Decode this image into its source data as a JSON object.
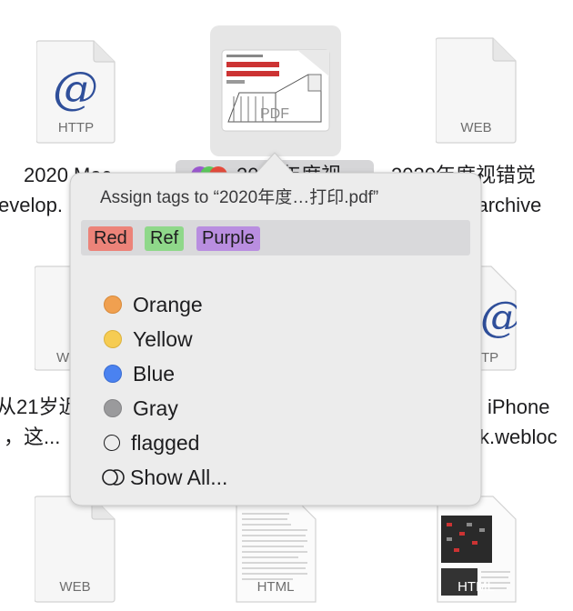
{
  "files": {
    "top_left": {
      "badge": "HTTP",
      "label1": "2020 Mac",
      "label2": "evelop."
    },
    "top_center": {
      "badge": "PDF",
      "label": "2020年度视"
    },
    "top_right": {
      "badge": "WEB",
      "label1": "2020年度视错觉",
      "label2": ".webarchive"
    },
    "mid_left": {
      "badge": "WE",
      "label1": "从21岁近",
      "label2": "，这..."
    },
    "mid_right": {
      "badge": "TP",
      "label1": "iPhone",
      "label2": "k.webloc"
    },
    "bottom_left": {
      "badge": "WEB"
    },
    "bottom_center": {
      "badge": "HTML"
    },
    "bottom_right": {
      "badge": "HTML"
    }
  },
  "popover": {
    "title": "Assign tags to “2020年度…打印.pdf”",
    "assigned_tags": [
      {
        "label": "Red",
        "color": "#ec8379"
      },
      {
        "label": "Ref",
        "color": "#8fd88a"
      },
      {
        "label": "Purple",
        "color": "#b98ee0"
      }
    ],
    "menu": [
      {
        "label": "Orange",
        "color": "#f0a050"
      },
      {
        "label": "Yellow",
        "color": "#f6cc52"
      },
      {
        "label": "Blue",
        "color": "#4a82f0"
      },
      {
        "label": "Gray",
        "color": "#9a9a9c"
      },
      {
        "label": "flagged",
        "color": ""
      },
      {
        "label": "Show All...",
        "color": ""
      }
    ]
  }
}
